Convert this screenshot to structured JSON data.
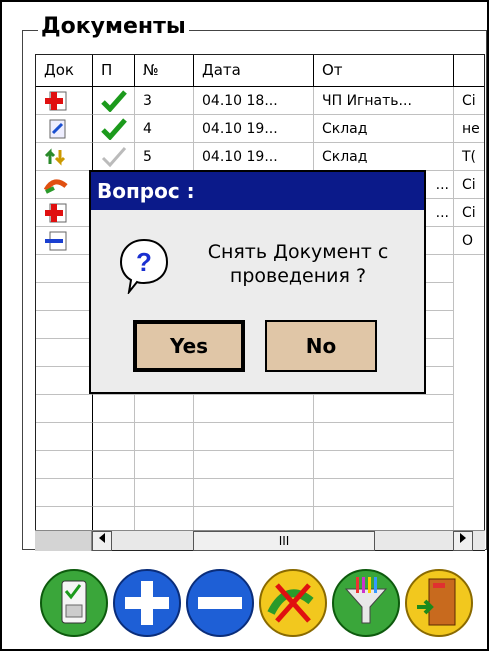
{
  "group": {
    "title": "Документы"
  },
  "grid": {
    "columns": [
      "Док",
      "П",
      "№",
      "Дата",
      "От",
      ""
    ],
    "rows": [
      {
        "doc_icon": "doc-red-plus-icon",
        "posted": "check",
        "num": "3",
        "date": "04.10 18...",
        "from": "ЧП Игнать...",
        "extra": "Ci"
      },
      {
        "doc_icon": "doc-edit-icon",
        "posted": "check",
        "num": "4",
        "date": "04.10 19...",
        "from": "Склад",
        "extra": "не"
      },
      {
        "doc_icon": "doc-transfer-icon",
        "posted": "check-gray",
        "num": "5",
        "date": "04.10 19...",
        "from": "Склад",
        "extra": "Т("
      },
      {
        "doc_icon": "doc-return-icon",
        "posted": "",
        "num": "",
        "date": "",
        "from": "...",
        "extra": "Ci"
      },
      {
        "doc_icon": "doc-red-plus-icon",
        "posted": "",
        "num": "",
        "date": "",
        "from": "...",
        "extra": "Ci"
      },
      {
        "doc_icon": "doc-minus-icon",
        "posted": "",
        "num": "",
        "date": "",
        "from": "",
        "extra": "O"
      }
    ],
    "scroll_thumb": "III"
  },
  "toolbar": {
    "buttons": [
      {
        "name": "post-document-icon"
      },
      {
        "name": "add-icon"
      },
      {
        "name": "remove-icon"
      },
      {
        "name": "cancel-return-icon"
      },
      {
        "name": "filter-icon"
      },
      {
        "name": "exit-icon"
      }
    ]
  },
  "dialog": {
    "title": "Вопрос :",
    "message_line1": "Снять Документ с",
    "message_line2": "проведения ?",
    "yes_label": "Yes",
    "no_label": "No"
  },
  "colors": {
    "dialog_title_bg": "#0b1a8a",
    "button_bg": "#e0c6a7",
    "check_green": "#1c9a1c"
  }
}
